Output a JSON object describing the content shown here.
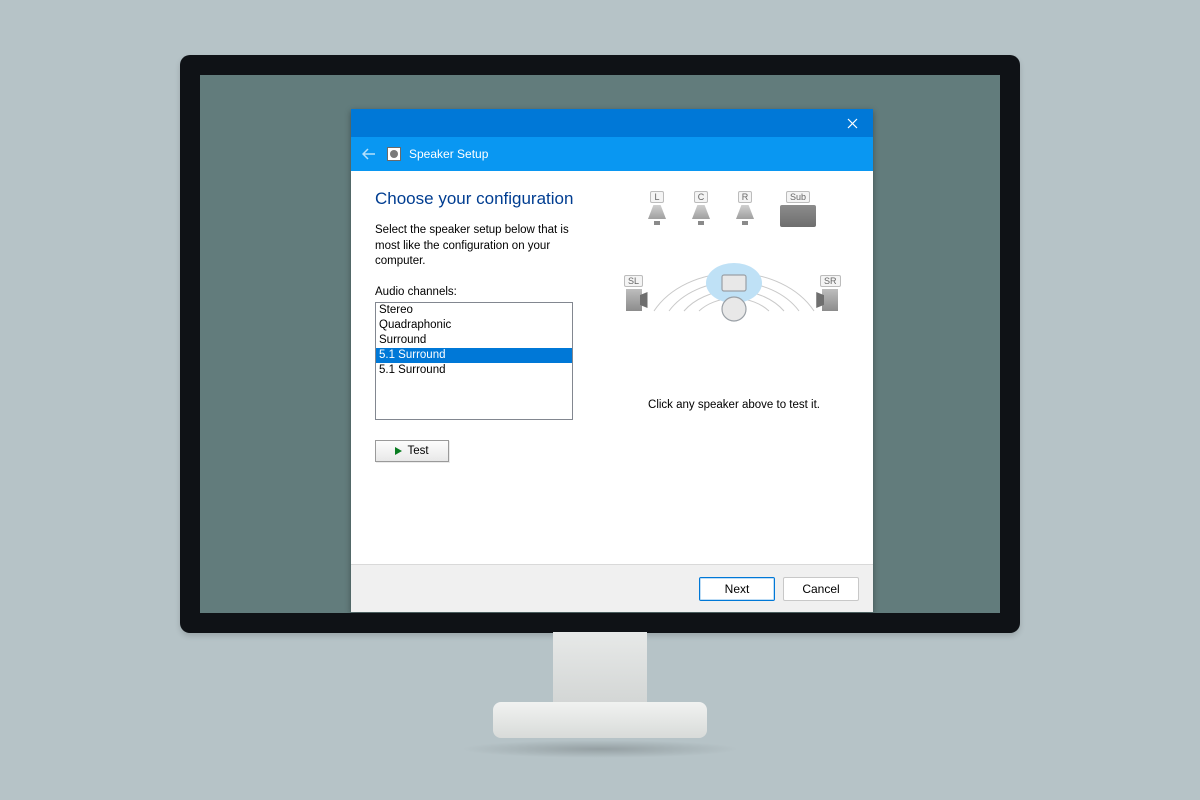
{
  "window": {
    "title": "Speaker Setup"
  },
  "content": {
    "heading": "Choose your configuration",
    "description": "Select the speaker setup below that is most like the configuration on your computer.",
    "channels_label": "Audio channels:",
    "channels": [
      "Stereo",
      "Quadraphonic",
      "Surround",
      "5.1 Surround",
      "5.1 Surround"
    ],
    "selected_channel_index": 3,
    "test_label": "Test",
    "hint": "Click any speaker above to test it."
  },
  "speakers": {
    "front_left": "L",
    "center": "C",
    "front_right": "R",
    "sub": "Sub",
    "side_left": "SL",
    "side_right": "SR"
  },
  "footer": {
    "next": "Next",
    "cancel": "Cancel"
  }
}
